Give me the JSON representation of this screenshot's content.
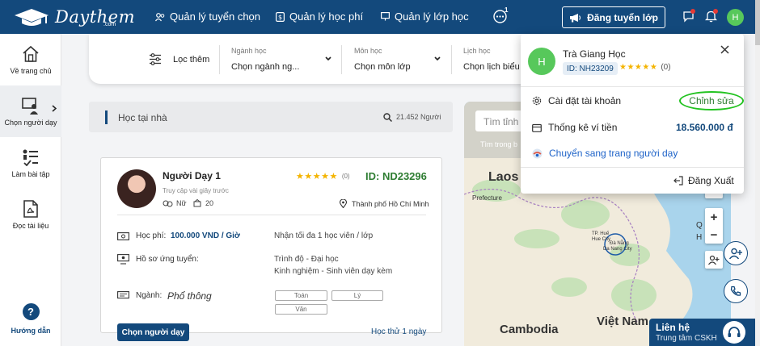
{
  "header": {
    "logo_text": "Daythem",
    "logo_sub": ".com",
    "nav": [
      {
        "label": "Quản lý tuyển chọn"
      },
      {
        "label": "Quản lý học phí"
      },
      {
        "label": "Quản lý lớp học"
      }
    ],
    "notification_badge": "1",
    "post_button": "Đăng tuyển lớp",
    "avatar_initial": "H"
  },
  "sidebar": {
    "items": [
      {
        "label": "Về trang chủ",
        "icon": "home-icon"
      },
      {
        "label": "Chọn người dạy",
        "icon": "choose-teacher-icon"
      },
      {
        "label": "Làm bài tập",
        "icon": "exercise-icon"
      },
      {
        "label": "Đọc tài liệu",
        "icon": "pdf-icon"
      }
    ],
    "help_label": "Hướng dẫn",
    "help_glyph": "?"
  },
  "filters": {
    "more_label": "Lọc thêm",
    "groups": [
      {
        "label": "Ngành học",
        "value": "Chọn ngành ng..."
      },
      {
        "label": "Môn học",
        "value": "Chọn môn lớp"
      },
      {
        "label": "Lịch học",
        "value": "Chọn lịch biểu"
      }
    ]
  },
  "search_strip": {
    "text": "Học tại nhà",
    "count": "21.452 Người"
  },
  "teacher_card": {
    "name": "Người Dạy 1",
    "last_access": "Truy cập vài giây trước",
    "gender": "Nữ",
    "count": "20",
    "rating_count": "(0)",
    "id": "ID: ND23296",
    "city": "Thành phố Hồ Chí Minh",
    "fee_label": "Học phí:",
    "fee_value": "100.000 VND / Giờ",
    "capacity": "Nhận tối đa 1 học viên / lớp",
    "profile_label": "Hồ sơ ứng tuyển:",
    "degree": "Trình độ - Đại học",
    "experience": "Kinh nghiệm - Sinh viên dạy kèm",
    "field_label": "Ngành:",
    "field_value": "Phổ thông",
    "subjects": [
      "Toán",
      "Lý",
      "Văn"
    ],
    "choose_button": "Chọn người dạy",
    "trial": "Học thử 1 ngày"
  },
  "map": {
    "search_placeholder": "Tìm tỉnh",
    "hint": "Tìm trong b",
    "labels": {
      "laos": "Laos",
      "prefecture": "Prefecture",
      "hue": "TP. Huế",
      "hue2": "Hue City",
      "danang": "Đà Nẵng",
      "danang2": "Da Nang City",
      "q": "Q",
      "h": "H",
      "cambodia": "Cambodia",
      "vietnam": "Việt Nam"
    },
    "zoom_in": "+",
    "zoom_out": "−"
  },
  "contact": {
    "title": "Liên hệ",
    "subtitle": "Trung tâm CSKH"
  },
  "account_menu": {
    "avatar_initial": "H",
    "name": "Trà Giang Học",
    "id": "ID: NH23209",
    "rating_count": "(0)",
    "settings_label": "Cài đặt tài khoản",
    "edit_label": "Chỉnh sửa",
    "wallet_label": "Thống kê ví tiền",
    "balance": "18.560.000 đ",
    "switch_label": "Chuyển sang trang người dạy",
    "logout_label": "Đăng Xuất"
  },
  "colors": {
    "brand": "#13497c",
    "accent_green": "#57c85b",
    "star": "#f4b400",
    "highlight": "#22c320"
  }
}
